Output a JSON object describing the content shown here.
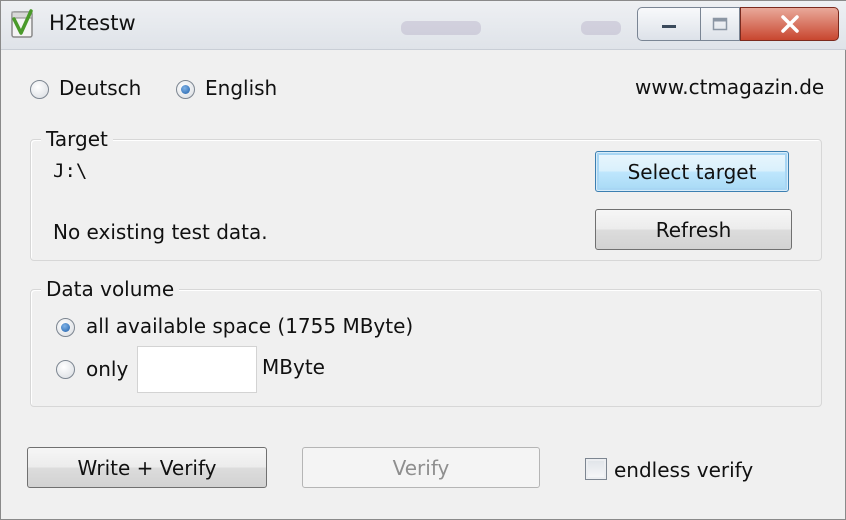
{
  "window": {
    "title": "H2testw",
    "controls": [
      "minimize-icon",
      "maximize-icon",
      "close-icon"
    ]
  },
  "language": {
    "options": [
      {
        "label": "Deutsch",
        "selected": false
      },
      {
        "label": "English",
        "selected": true
      }
    ],
    "website": "www.ctmagazin.de"
  },
  "target": {
    "group_label": "Target",
    "path": "J:\\",
    "status": "No existing test data.",
    "select_button": "Select target",
    "refresh_button": "Refresh"
  },
  "data_volume": {
    "group_label": "Data volume",
    "all_option": "all available space (1755 MByte)",
    "all_selected": true,
    "only_option": "only",
    "only_value": "",
    "unit": "MByte"
  },
  "actions": {
    "write_verify": "Write + Verify",
    "verify": "Verify",
    "verify_enabled": false,
    "endless_verify": "endless verify",
    "endless_checked": false
  },
  "colors": {
    "close_button": "#c8462f",
    "focus_blue": "#3c7fb1",
    "radio_selected": "#1f5fa9"
  }
}
